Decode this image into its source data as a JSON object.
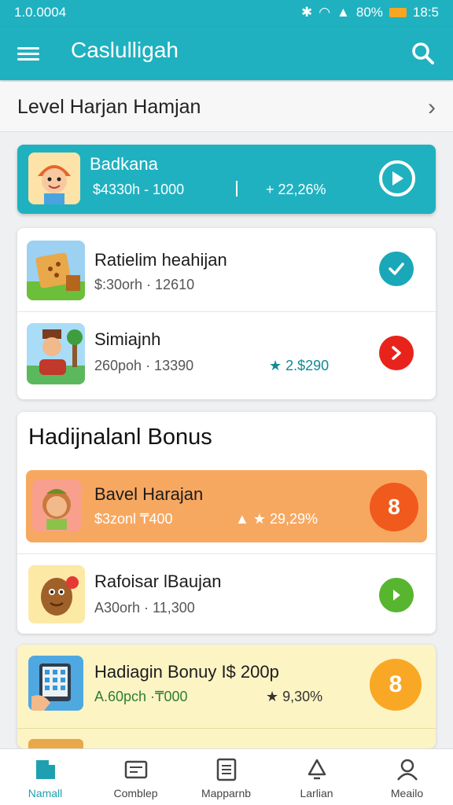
{
  "status": {
    "left_text": "1.0.0004",
    "signal_text": "80%",
    "time": "18:5"
  },
  "appbar": {
    "title": "Caslulligah"
  },
  "level_header": {
    "title": "Level Harjan Hamjan"
  },
  "featured": {
    "name": "Badkana",
    "meta": "$4330h - 1000",
    "extra": "+ 22,26%"
  },
  "list1": [
    {
      "name": "Ratielim heahijan",
      "meta": "$:30orh · 12610",
      "extra": ""
    },
    {
      "name": "Simiajnh",
      "meta": "260poh · 13390",
      "extra": "★ 2.$290"
    }
  ],
  "bonus": {
    "title": "Hadijnalanl Bonus",
    "items": [
      {
        "name": "Bavel Harajan",
        "meta": "$3zonl ₸400",
        "extra": "▲ ★ 29,29%",
        "badge": "8"
      },
      {
        "name": "Rafoisar lBaujan",
        "meta": "A30orh · 11,300",
        "extra": "",
        "badge": ""
      }
    ]
  },
  "promo": {
    "name": "Hadiagin Bonuy I$ 200p",
    "meta": "A.60pch ·₸000",
    "extra": "★ 9,30%",
    "badge": "8"
  },
  "nav": [
    {
      "label": "Namall"
    },
    {
      "label": "Comblep"
    },
    {
      "label": "Mapparnb"
    },
    {
      "label": "Larlian"
    },
    {
      "label": "Meailo"
    }
  ],
  "colors": {
    "teal": "#1fb1c0",
    "orange": "#f7a860",
    "red": "#e8231c",
    "green": "#57b530",
    "yellow": "#fdf4c4"
  }
}
